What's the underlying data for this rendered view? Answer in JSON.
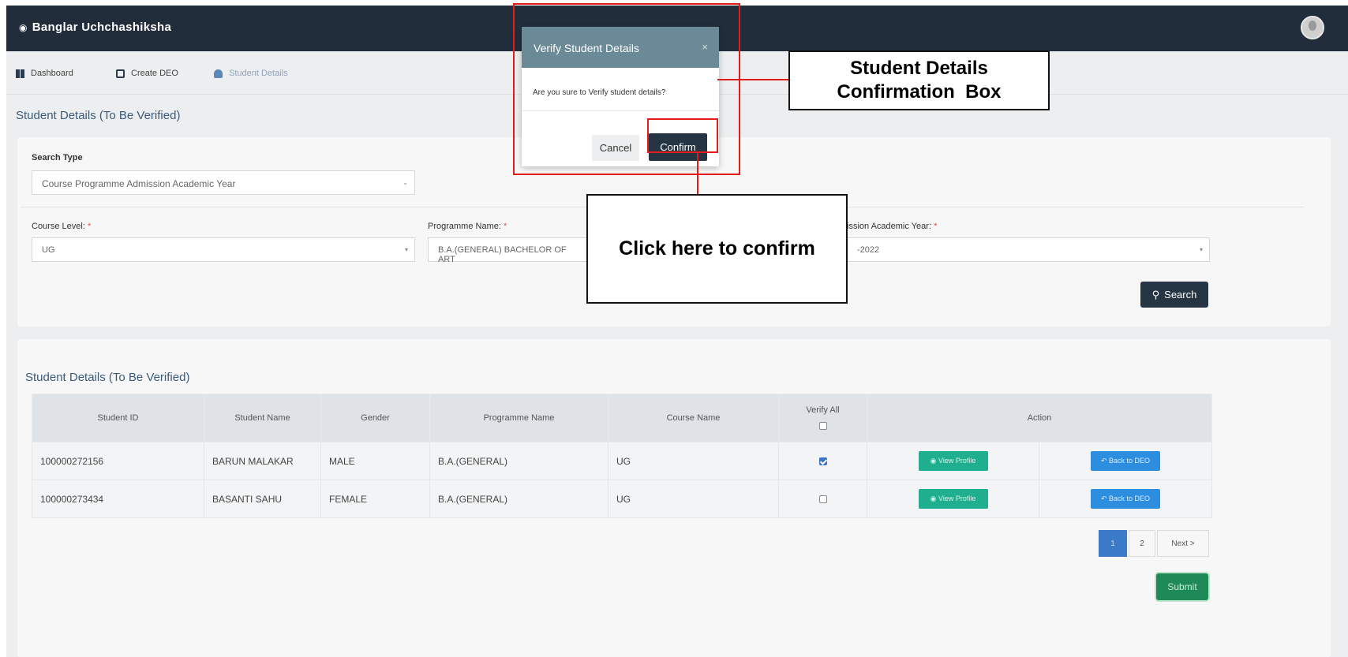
{
  "app": {
    "title": "Banglar Uchchashiksha",
    "icon": "graduation-cap-icon"
  },
  "nav": {
    "items": [
      {
        "label": "Dashboard",
        "icon": "grid-icon"
      },
      {
        "label": "Create DEO",
        "icon": "document-icon"
      },
      {
        "label": "Student Details",
        "icon": "user-icon"
      }
    ]
  },
  "page": {
    "heading": "Student Details (To Be Verified)"
  },
  "filters": {
    "search_type_label": "Search Type",
    "search_type_value": "Course Programme Admission Academic Year",
    "course_level_label": "Course Level:",
    "course_level_value": "UG",
    "programme_label": "Programme Name:",
    "programme_value": "B.A.(GENERAL) BACHELOR OF ART",
    "year_label": "ission Academic Year:",
    "year_value": "-2022",
    "required_mark": "*",
    "search_button": "Search"
  },
  "table": {
    "heading": "Student Details (To Be Verified)",
    "columns": [
      "Student ID",
      "Student Name",
      "Gender",
      "Programme Name",
      "Course Name",
      "Verify All",
      "Action"
    ],
    "rows": [
      {
        "id": "100000272156",
        "name": "BARUN MALAKAR",
        "gender": "MALE",
        "programme": "B.A.(GENERAL)",
        "course": "UG",
        "verified": true,
        "view": "View Profile",
        "back": "Back to DEO"
      },
      {
        "id": "100000273434",
        "name": "BASANTI SAHU",
        "gender": "FEMALE",
        "programme": "B.A.(GENERAL)",
        "course": "UG",
        "verified": false,
        "view": "View Profile",
        "back": "Back to DEO"
      }
    ]
  },
  "pagination": {
    "page1": "1",
    "page2": "2",
    "next": "Next >"
  },
  "submit_button": "Submit",
  "modal": {
    "title": "Verify Student Details",
    "close": "×",
    "message": "Are you sure to Verify student details?",
    "cancel": "Cancel",
    "confirm": "Confirm"
  },
  "annotations": {
    "box_label_line1": "Student Details",
    "box_label_line2": "Confirmation  Box",
    "confirm_label": "Click here to confirm",
    "color": "#e31b1b"
  }
}
